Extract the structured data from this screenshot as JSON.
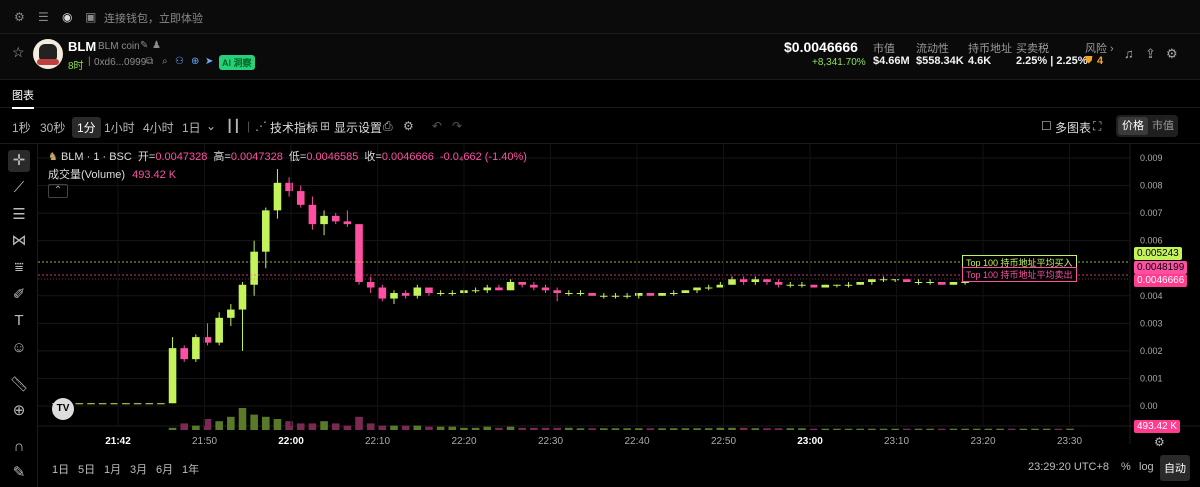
{
  "topbar": {
    "wallet_text": "连接钱包，立即体验"
  },
  "token": {
    "symbol": "BLM",
    "name": "BLM coin",
    "age": "8时",
    "address": "0xd6...0999",
    "ai_badge": "AI 洞察"
  },
  "price": {
    "value": "$0.0046666",
    "change": "+8,341.70%"
  },
  "stats": [
    {
      "label": "市值",
      "value": "$4.66M"
    },
    {
      "label": "流动性",
      "value": "$558.34K"
    },
    {
      "label": "持币地址",
      "value": "4.6K"
    },
    {
      "label": "买卖税",
      "value": "2.25% | 2.25%"
    },
    {
      "label": "风险 ›",
      "value": "4"
    }
  ],
  "tabs": {
    "chart": "图表"
  },
  "toolbar": {
    "intervals": [
      "1秒",
      "30秒",
      "1分",
      "1小时",
      "4小时",
      "1日"
    ],
    "active_interval": "1分",
    "indicators": "技术指标",
    "display": "显示设置",
    "multi_chart": "多图表",
    "price": "价格",
    "mcap": "市值"
  },
  "legend": {
    "title": "BLM · 1 · BSC",
    "open_label": "开=",
    "open": "0.0047328",
    "high_label": "高=",
    "high": "0.0047328",
    "low_label": "低=",
    "low": "0.0046585",
    "close_label": "收=",
    "close": "0.0046666",
    "change": "-0.0₄662 (-1.40%)",
    "volume_label": "成交量(Volume)",
    "volume": "493.42 K"
  },
  "markers": {
    "buy_label": "Top 100 持币地址平均买入",
    "sell_label": "Top 100 持币地址平均卖出",
    "buy_price": "0.005243",
    "sell_price": "0.0048199",
    "last_price": "0.0046666",
    "volume_tag": "493.42 K"
  },
  "bottom": {
    "ranges": [
      "1日",
      "5日",
      "1月",
      "3月",
      "6月",
      "1年"
    ],
    "time": "23:29:20 UTC+8",
    "pct": "%",
    "log": "log",
    "auto": "自动"
  },
  "colors": {
    "up": "#c4f25a",
    "down": "#ff4fa3",
    "buy_line": "#c4f25a",
    "sell_line": "#ff4fa3"
  },
  "chart_data": {
    "type": "bar",
    "subtype": "candlestick",
    "title": "BLM · 1 · BSC",
    "y_ticks": [
      "0.009",
      "0.008",
      "0.007",
      "0.006",
      "0.004",
      "0.003",
      "0.002",
      "0.001",
      "0.00"
    ],
    "ylim": [
      0,
      0.009
    ],
    "x_ticks": [
      "21:42",
      "21:50",
      "22:00",
      "22:10",
      "22:20",
      "22:30",
      "22:40",
      "22:50",
      "23:00",
      "23:10",
      "23:20",
      "23:30"
    ],
    "bold_ticks": [
      "21:42",
      "22:00",
      "23:00"
    ],
    "candles": [
      [
        0.0001,
        0.0001,
        0.0001,
        0.0001
      ],
      [
        0.0001,
        0.0001,
        0.0001,
        0.0001
      ],
      [
        0.0001,
        0.0001,
        0.0001,
        0.0001
      ],
      [
        0.0001,
        0.0001,
        0.0001,
        0.0001
      ],
      [
        0.0001,
        0.0001,
        0.0001,
        0.0001
      ],
      [
        0.0001,
        0.0001,
        0.0001,
        0.0001
      ],
      [
        0.0001,
        0.0001,
        0.0001,
        0.0001
      ],
      [
        0.0001,
        0.0001,
        0.0001,
        0.0001
      ],
      [
        0.0001,
        0.0001,
        0.0001,
        0.0001
      ],
      [
        0.0001,
        0.0001,
        0.0001,
        0.0001
      ],
      [
        0.0001,
        0.0025,
        0.0001,
        0.0021
      ],
      [
        0.0021,
        0.0022,
        0.0016,
        0.0017
      ],
      [
        0.0017,
        0.0026,
        0.0016,
        0.0025
      ],
      [
        0.0025,
        0.003,
        0.0022,
        0.0023
      ],
      [
        0.0023,
        0.0034,
        0.0022,
        0.0032
      ],
      [
        0.0032,
        0.0037,
        0.0029,
        0.0035
      ],
      [
        0.0035,
        0.0045,
        0.002,
        0.0044
      ],
      [
        0.0044,
        0.006,
        0.004,
        0.0056
      ],
      [
        0.0056,
        0.0072,
        0.005,
        0.0071
      ],
      [
        0.0071,
        0.0086,
        0.0068,
        0.0081
      ],
      [
        0.0081,
        0.0083,
        0.0076,
        0.0078
      ],
      [
        0.0078,
        0.008,
        0.0072,
        0.0073
      ],
      [
        0.0073,
        0.0076,
        0.0064,
        0.0066
      ],
      [
        0.0066,
        0.0071,
        0.0062,
        0.0069
      ],
      [
        0.0069,
        0.007,
        0.0066,
        0.0067
      ],
      [
        0.0067,
        0.0071,
        0.0065,
        0.0066
      ],
      [
        0.0066,
        0.0066,
        0.0044,
        0.0045
      ],
      [
        0.0045,
        0.0047,
        0.0041,
        0.0043
      ],
      [
        0.0043,
        0.0044,
        0.0038,
        0.0039
      ],
      [
        0.0039,
        0.0042,
        0.0037,
        0.0041
      ],
      [
        0.0041,
        0.0042,
        0.0039,
        0.004
      ],
      [
        0.004,
        0.0044,
        0.0039,
        0.0043
      ],
      [
        0.0043,
        0.0043,
        0.004,
        0.0041
      ],
      [
        0.0041,
        0.0042,
        0.004,
        0.0041
      ],
      [
        0.0041,
        0.0042,
        0.004,
        0.0041
      ],
      [
        0.0041,
        0.0043,
        0.004,
        0.0042
      ],
      [
        0.0042,
        0.0043,
        0.0041,
        0.0042
      ],
      [
        0.0042,
        0.0044,
        0.0041,
        0.0043
      ],
      [
        0.0043,
        0.0044,
        0.0042,
        0.0042
      ],
      [
        0.0042,
        0.0046,
        0.0042,
        0.0045
      ],
      [
        0.0045,
        0.0045,
        0.0043,
        0.0044
      ],
      [
        0.0044,
        0.0045,
        0.0042,
        0.0043
      ],
      [
        0.0043,
        0.0044,
        0.0041,
        0.0042
      ],
      [
        0.0042,
        0.0043,
        0.0038,
        0.0041
      ],
      [
        0.0041,
        0.0042,
        0.004,
        0.0041
      ],
      [
        0.0041,
        0.0042,
        0.004,
        0.0041
      ],
      [
        0.0041,
        0.0041,
        0.004,
        0.004
      ],
      [
        0.004,
        0.0041,
        0.0039,
        0.004
      ],
      [
        0.004,
        0.0041,
        0.0039,
        0.004
      ],
      [
        0.004,
        0.0041,
        0.0039,
        0.004
      ],
      [
        0.004,
        0.0041,
        0.0039,
        0.0041
      ],
      [
        0.0041,
        0.0041,
        0.004,
        0.004
      ],
      [
        0.004,
        0.0041,
        0.004,
        0.0041
      ],
      [
        0.0041,
        0.0042,
        0.004,
        0.0041
      ],
      [
        0.0041,
        0.0042,
        0.0041,
        0.0042
      ],
      [
        0.0042,
        0.0043,
        0.0041,
        0.0043
      ],
      [
        0.0043,
        0.0044,
        0.0042,
        0.0043
      ],
      [
        0.0043,
        0.0045,
        0.0043,
        0.0044
      ],
      [
        0.0044,
        0.0047,
        0.0044,
        0.0046
      ],
      [
        0.0046,
        0.0047,
        0.0044,
        0.0045
      ],
      [
        0.0045,
        0.0047,
        0.0044,
        0.0046
      ],
      [
        0.0046,
        0.0046,
        0.0044,
        0.0045
      ],
      [
        0.0045,
        0.0046,
        0.0043,
        0.0044
      ],
      [
        0.0044,
        0.0045,
        0.0043,
        0.0044
      ],
      [
        0.0044,
        0.0045,
        0.0043,
        0.0044
      ],
      [
        0.0044,
        0.0044,
        0.0043,
        0.0043
      ],
      [
        0.0043,
        0.0044,
        0.0043,
        0.0044
      ],
      [
        0.0044,
        0.0044,
        0.0043,
        0.0044
      ],
      [
        0.0044,
        0.0045,
        0.0043,
        0.0044
      ],
      [
        0.0044,
        0.0045,
        0.0044,
        0.0045
      ],
      [
        0.0045,
        0.0046,
        0.0044,
        0.0046
      ],
      [
        0.0046,
        0.0047,
        0.0045,
        0.0046
      ],
      [
        0.0046,
        0.0046,
        0.0045,
        0.0046
      ],
      [
        0.0046,
        0.0046,
        0.0045,
        0.0045
      ],
      [
        0.0045,
        0.0046,
        0.0044,
        0.0045
      ],
      [
        0.0045,
        0.0046,
        0.0044,
        0.0045
      ],
      [
        0.0045,
        0.0045,
        0.0044,
        0.0044
      ],
      [
        0.0044,
        0.0045,
        0.0044,
        0.0045
      ],
      [
        0.0045,
        0.0046,
        0.0044,
        0.0045
      ],
      [
        0.0045,
        0.0046,
        0.0045,
        0.0046
      ],
      [
        0.0046,
        0.0047,
        0.0045,
        0.0046
      ],
      [
        0.0046,
        0.0047,
        0.0045,
        0.0047
      ],
      [
        0.0047,
        0.0047,
        0.0046,
        0.0046
      ],
      [
        0.0046,
        0.0047,
        0.0046,
        0.0047
      ],
      [
        0.0047,
        0.0047,
        0.0046,
        0.0047
      ],
      [
        0.0047,
        0.0048,
        0.0046,
        0.0047
      ],
      [
        0.0047,
        0.0048,
        0.0046,
        0.0046
      ],
      [
        0.0046,
        0.0047,
        0.0046,
        0.0047
      ]
    ],
    "volumes": [
      0,
      0,
      0,
      0,
      0,
      0,
      0,
      0,
      0,
      0,
      0.1,
      0.3,
      0.2,
      0.5,
      0.4,
      0.6,
      1.0,
      0.7,
      0.6,
      0.5,
      0.4,
      0.3,
      0.3,
      0.4,
      0.3,
      0.2,
      0.6,
      0.3,
      0.2,
      0.2,
      0.2,
      0.2,
      0.15,
      0.15,
      0.15,
      0.1,
      0.1,
      0.15,
      0.1,
      0.15,
      0.1,
      0.1,
      0.1,
      0.1,
      0.1,
      0.08,
      0.08,
      0.08,
      0.08,
      0.08,
      0.08,
      0.08,
      0.08,
      0.08,
      0.08,
      0.08,
      0.08,
      0.1,
      0.1,
      0.1,
      0.08,
      0.08,
      0.08,
      0.08,
      0.08,
      0.06,
      0.06,
      0.06,
      0.06,
      0.06,
      0.06,
      0.06,
      0.06,
      0.06,
      0.06,
      0.06,
      0.06,
      0.06,
      0.06,
      0.06,
      0.06,
      0.06,
      0.06,
      0.06,
      0.06,
      0.06,
      0.06,
      0.06
    ]
  }
}
